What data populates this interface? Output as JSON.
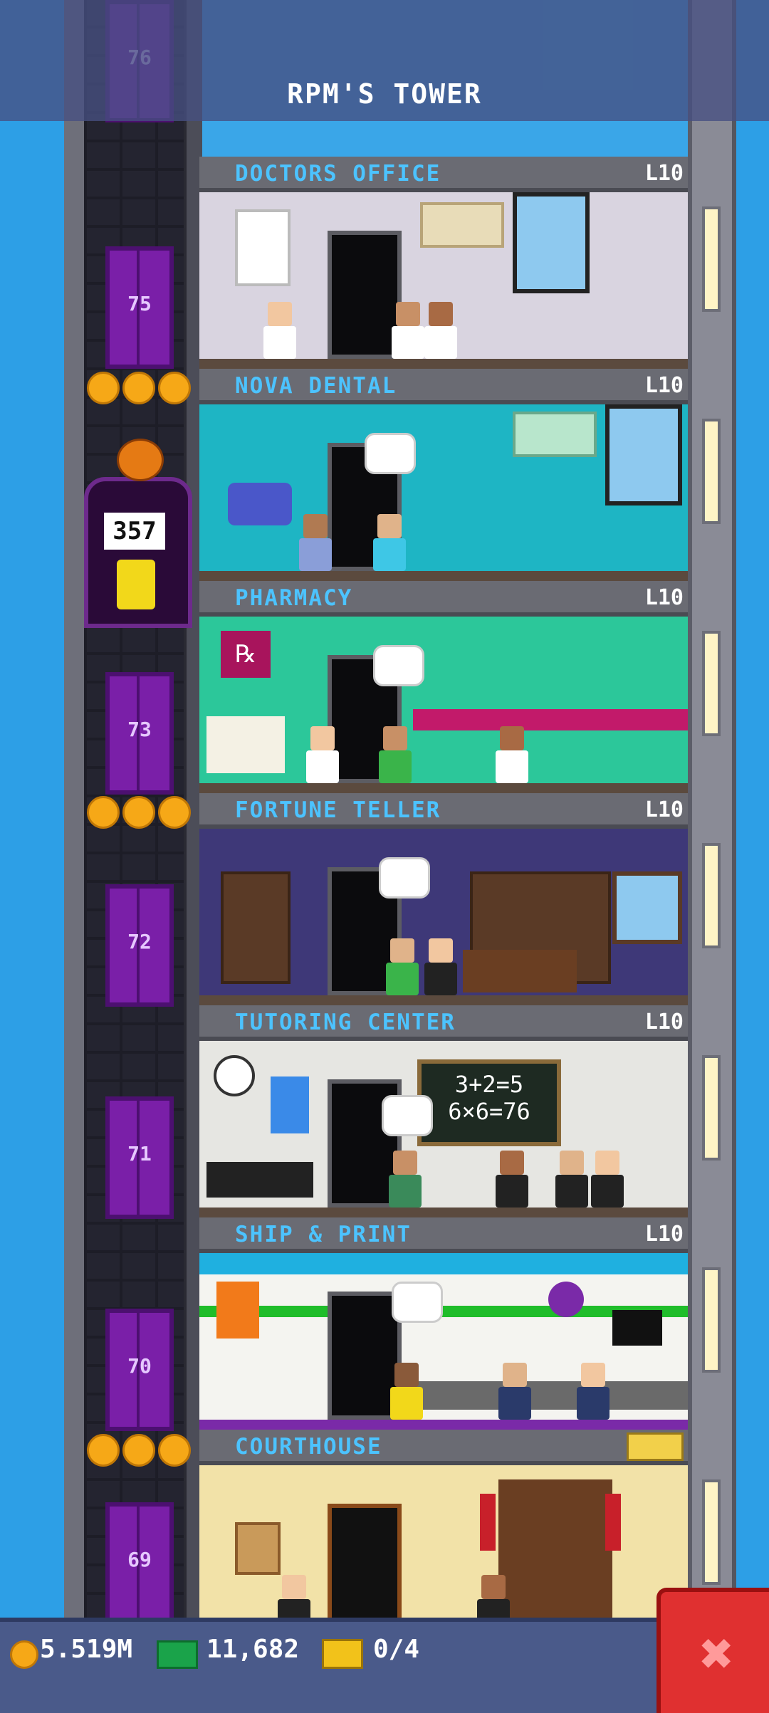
{
  "header": {
    "title": "RPM'S TOWER",
    "top_floor_number": "76"
  },
  "floors": [
    {
      "name": "DOCTORS OFFICE",
      "level": "L10",
      "elevator_floor": "75",
      "coins": false
    },
    {
      "name": "NOVA DENTAL",
      "level": "L10",
      "elevator_floor": "",
      "coins": true
    },
    {
      "name": "PHARMACY",
      "level": "L10",
      "elevator_floor": "73",
      "coins": false
    },
    {
      "name": "FORTUNE TELLER",
      "level": "L10",
      "elevator_floor": "72",
      "coins": true
    },
    {
      "name": "TUTORING CENTER",
      "level": "L10",
      "elevator_floor": "71",
      "coins": false
    },
    {
      "name": "SHIP & PRINT",
      "level": "L10",
      "elevator_floor": "70",
      "coins": false
    },
    {
      "name": "COURTHOUSE",
      "level": "",
      "elevator_floor": "69",
      "coins": true
    }
  ],
  "elevator_cab": {
    "passenger_count": "357"
  },
  "chalkboard": {
    "line1": "3+2=5",
    "line2": "6×6=76"
  },
  "stats": {
    "coins": "5.519M",
    "bux": "11,682",
    "tickets": "0/4"
  },
  "colors": {
    "sky": "#2d9fe6",
    "header": "#46508c",
    "label": "#4cc3ff",
    "elevator": "#7a1fa8",
    "close": "#e03030"
  }
}
